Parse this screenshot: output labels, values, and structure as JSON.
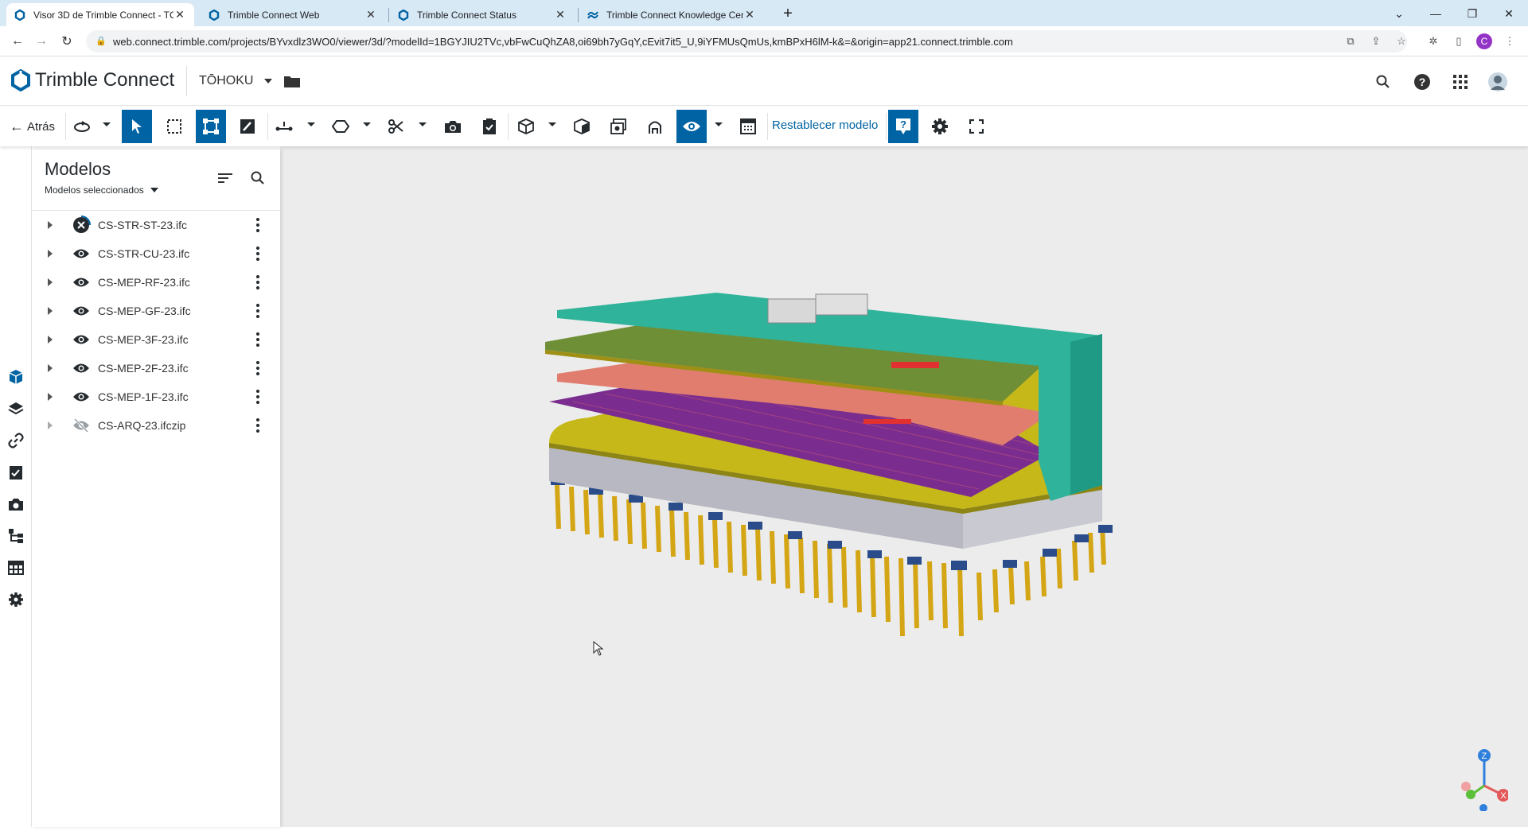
{
  "browser": {
    "tabs": [
      {
        "label": "Visor 3D de Trimble Connect - TC",
        "active": true
      },
      {
        "label": "Trimble Connect Web",
        "active": false
      },
      {
        "label": "Trimble Connect Status",
        "active": false
      },
      {
        "label": "Trimble Connect Knowledge Cen",
        "active": false
      }
    ],
    "url": "web.connect.trimble.com/projects/BYvxdlz3WO0/viewer/3d/?modelId=1BGYJIU2TVc,vbFwCuQhZA8,oi69bh7yGqY,cEvit7it5_U,9iYFMUsQmUs,kmBPxH6lM-k&=&origin=app21.connect.trimble.com",
    "profile_initial": "C"
  },
  "header": {
    "brand": "Trimble Connect",
    "project": "TŌHOKU"
  },
  "toolbar": {
    "back_label": "Atrás",
    "reset_label": "Restablecer modelo"
  },
  "panel": {
    "title": "Modelos",
    "subtitle": "Modelos seleccionados",
    "models": [
      {
        "name": "CS-STR-ST-23.ifc",
        "visibility": "close"
      },
      {
        "name": "CS-STR-CU-23.ifc",
        "visibility": "visible"
      },
      {
        "name": "CS-MEP-RF-23.ifc",
        "visibility": "visible"
      },
      {
        "name": "CS-MEP-GF-23.ifc",
        "visibility": "visible"
      },
      {
        "name": "CS-MEP-3F-23.ifc",
        "visibility": "visible"
      },
      {
        "name": "CS-MEP-2F-23.ifc",
        "visibility": "visible"
      },
      {
        "name": "CS-MEP-1F-23.ifc",
        "visibility": "visible"
      },
      {
        "name": "CS-ARQ-23.ifczip",
        "visibility": "hidden"
      }
    ]
  },
  "gizmo": {
    "z_label": "Z",
    "x_label": "X"
  },
  "colors": {
    "accent": "#0063a3",
    "viewport_bg": "#ececec",
    "tabbar": "#d8e9f6"
  }
}
